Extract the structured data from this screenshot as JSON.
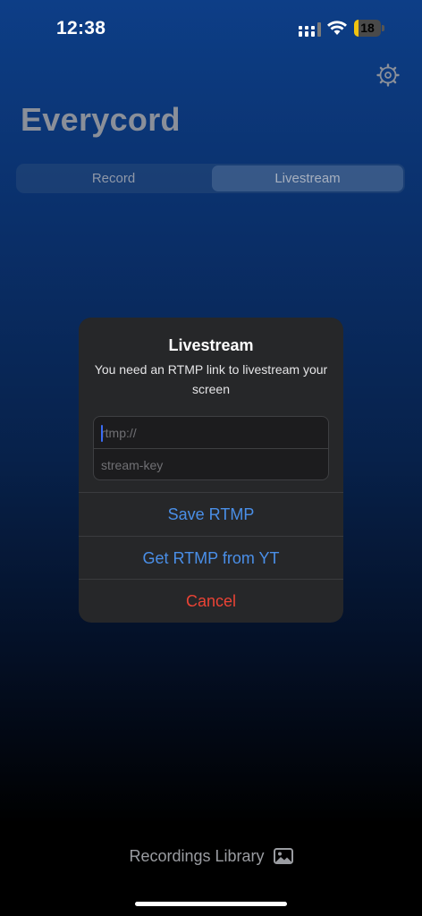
{
  "status_bar": {
    "time": "12:38",
    "battery_level": "18",
    "battery_fraction": 0.18,
    "icons": [
      "cellular-signal-icon",
      "wifi-icon",
      "battery-icon"
    ]
  },
  "header": {
    "settings_icon": "gear-icon",
    "title": "Everycord"
  },
  "segments": {
    "items": [
      {
        "label": "Record",
        "selected": false
      },
      {
        "label": "Livestream",
        "selected": true
      }
    ]
  },
  "alert": {
    "title": "Livestream",
    "message": "You need an RTMP link to livestream your screen",
    "rtmp_field": {
      "value": "",
      "placeholder": "rtmp://"
    },
    "key_field": {
      "value": "",
      "placeholder": "stream-key"
    },
    "save_label": "Save RTMP",
    "yt_label": "Get RTMP from YT",
    "cancel_label": "Cancel"
  },
  "library": {
    "label": "Recordings Library",
    "icon": "photo-icon"
  },
  "colors": {
    "accent_blue": "#4a8fe8",
    "cancel_red": "#ea4335",
    "battery_yellow": "#f1c40f"
  }
}
